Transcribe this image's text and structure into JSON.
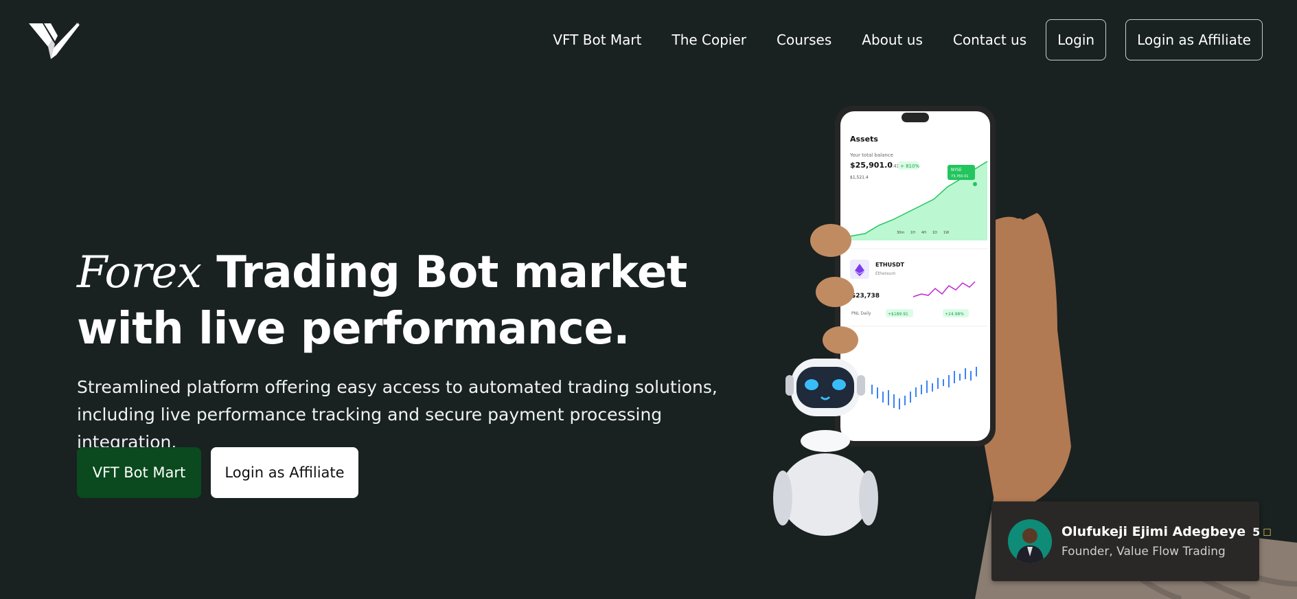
{
  "nav": {
    "items": [
      "VFT Bot Mart",
      "The Copier",
      "Courses",
      "About us",
      "Contact us"
    ],
    "login": "Login",
    "login_affiliate": "Login as Affiliate"
  },
  "hero": {
    "title_script": "Forex",
    "title_rest": " Trading Bot market with live performance.",
    "description": "Streamlined platform offering easy access to automated trading solutions, including live performance tracking and secure payment processing integration."
  },
  "cta": {
    "primary": "VFT Bot Mart",
    "secondary": "Login as Affiliate"
  },
  "phone": {
    "header": "Assets",
    "balance_label": "Your total balance",
    "balance": "$25,901.0",
    "balance_cents": ".41",
    "balance_change": "+ 810%",
    "sub_balance": "$1,521.4",
    "tooltip_label": "NYSE",
    "tooltip_value": "73,760.01",
    "time_tabs": [
      "30m",
      "1H",
      "4H",
      "1D",
      "1W"
    ],
    "asset_symbol": "ETHUSDT",
    "asset_name": "Ethereum",
    "asset_price": "$23,738",
    "pnl_label": "PNL Daily",
    "pnl_value": "+$189.91",
    "pnl_percent": "+24.98%"
  },
  "founder": {
    "name": "Olufukeji Ejimi Adegbeye",
    "rating": "5",
    "role": "Founder, Value Flow Trading"
  },
  "colors": {
    "background": "#1a2121",
    "primary_button": "#0a4a1e",
    "accent_green": "#22c55e"
  }
}
